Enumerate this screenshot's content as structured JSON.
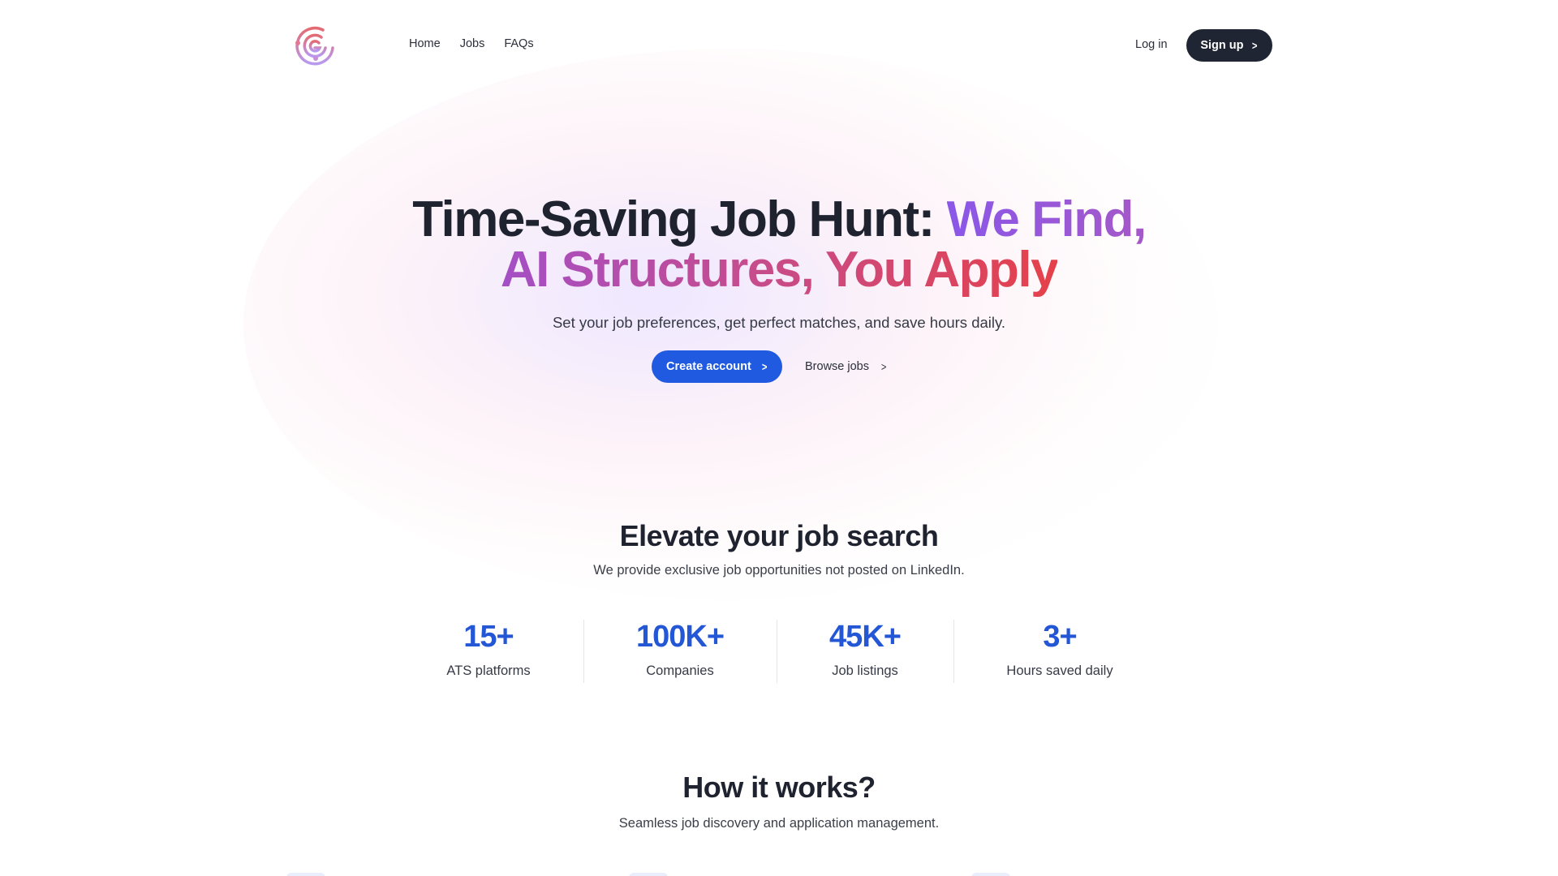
{
  "header": {
    "logo": "g-spiral-logo",
    "nav": [
      {
        "label": "Home"
      },
      {
        "label": "Jobs"
      },
      {
        "label": "FAQs"
      }
    ],
    "login_label": "Log in",
    "signup_label": "Sign up"
  },
  "hero": {
    "title_dark": "Time-Saving Job Hunt: ",
    "title_accent_1": "We Find,",
    "title_accent_2": "AI Structures, You Apply",
    "subtitle": "Set your job preferences, get perfect matches, and save hours daily.",
    "primary_cta": "Create account",
    "secondary_cta": "Browse jobs"
  },
  "elevate": {
    "title": "Elevate your job search",
    "subtitle": "We provide exclusive job opportunities not posted on LinkedIn.",
    "stats": [
      {
        "value": "15+",
        "label": "ATS platforms"
      },
      {
        "value": "100K+",
        "label": "Companies"
      },
      {
        "value": "45K+",
        "label": "Job listings"
      },
      {
        "value": "3+",
        "label": "Hours saved daily"
      }
    ]
  },
  "how": {
    "title": "How it works?",
    "subtitle": "Seamless job discovery and application management."
  },
  "colors": {
    "primary": "#1f5ae0",
    "dark": "#1f2532",
    "stat_blue": "#2457d6",
    "accent_purple": "#8a57e8",
    "accent_red": "#e5414a"
  }
}
